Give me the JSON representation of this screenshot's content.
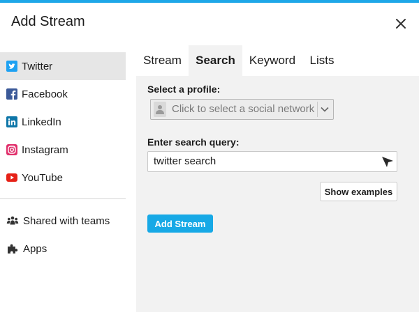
{
  "dialog": {
    "title": "Add Stream",
    "close_icon": "close-icon",
    "accent_color": "#1ea7e8"
  },
  "sidebar": {
    "networks": [
      {
        "label": "Twitter",
        "icon": "twitter-icon",
        "color": "#1da1f2",
        "active": true
      },
      {
        "label": "Facebook",
        "icon": "facebook-icon",
        "color": "#3b5998",
        "active": false
      },
      {
        "label": "LinkedIn",
        "icon": "linkedin-icon",
        "color": "#0e76a8",
        "active": false
      },
      {
        "label": "Instagram",
        "icon": "instagram-icon",
        "color": "#e1306c",
        "active": false
      },
      {
        "label": "YouTube",
        "icon": "youtube-icon",
        "color": "#e62117",
        "active": false
      }
    ],
    "extras": [
      {
        "label": "Shared with teams",
        "icon": "teams-icon"
      },
      {
        "label": "Apps",
        "icon": "puzzle-icon"
      }
    ]
  },
  "tabs": [
    {
      "label": "Stream",
      "active": false
    },
    {
      "label": "Search",
      "active": true
    },
    {
      "label": "Keyword",
      "active": false
    },
    {
      "label": "Lists",
      "active": false
    }
  ],
  "form": {
    "profile_label": "Select a profile:",
    "profile_placeholder": "Click to select a social network",
    "query_label": "Enter search query:",
    "query_value": "twitter search",
    "show_examples": "Show examples",
    "submit": "Add Stream",
    "submit_color": "#17a9e6"
  }
}
